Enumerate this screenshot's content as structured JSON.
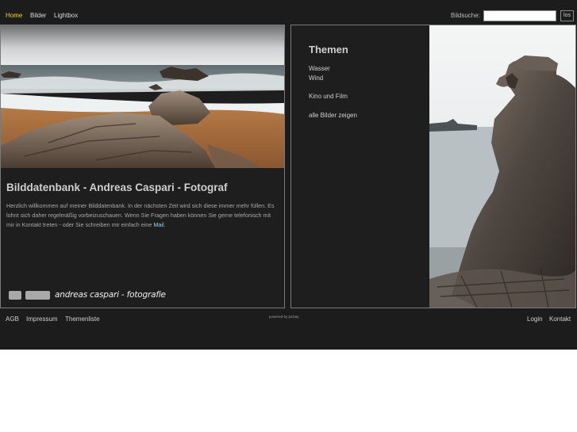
{
  "nav": {
    "items": [
      {
        "label": "Home",
        "active": true
      },
      {
        "label": "Bilder",
        "active": false
      },
      {
        "label": "Lightbox",
        "active": false
      }
    ]
  },
  "search": {
    "label": "Bildsuche:",
    "value": "",
    "button_label": "los"
  },
  "welcome": {
    "title": "Bilddatenbank  - Andreas Caspari - Fotograf",
    "text": "Herzlich willkommen auf meiner Bilddatenbank. In der nächsten Zeit wird sich diese immer mehr füllen. Es lohnt sich daher regelmäßig vorbeizuschauen. Wenn Sie Fragen haben können Sie gerne telefonisch mit mir in Kontakt treten - oder Sie schreiben mir einfach eine",
    "mail_link": "Mail",
    "after_mail": "."
  },
  "brand": {
    "signature": "andreas caspari - fotografie"
  },
  "themes": {
    "heading": "Themen",
    "items": [
      "Wasser",
      "Wind",
      "Kino und Film",
      "alle Bilder zeigen"
    ]
  },
  "footer": {
    "left_links": [
      "AGB",
      "Impressum",
      "Themenliste"
    ],
    "powered_by": "powered by picbay",
    "right_links": [
      "Login",
      "Kontakt"
    ]
  },
  "colors": {
    "background": "#1c1c1c",
    "active_nav": "#f2d21b",
    "link_accent": "#9fd0ec",
    "panel_border": "#7a7a7a"
  }
}
